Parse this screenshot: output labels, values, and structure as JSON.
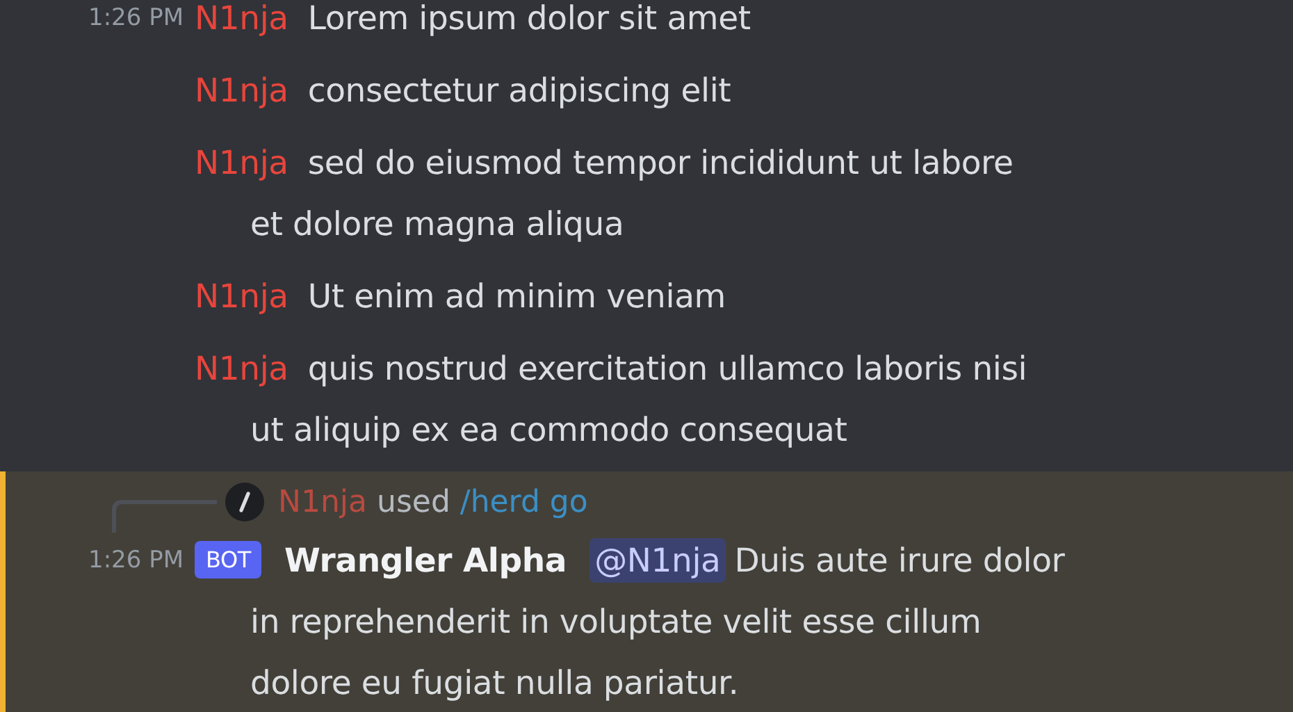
{
  "messages": [
    {
      "timestamp": "1:26 PM",
      "author": "N1nja",
      "lines": [
        "Lorem ipsum dolor sit amet"
      ]
    },
    {
      "author": "N1nja",
      "lines": [
        "consectetur adipiscing elit"
      ]
    },
    {
      "author": "N1nja",
      "lines": [
        "sed do eiusmod tempor incididunt ut labore",
        "et dolore magna aliqua"
      ]
    },
    {
      "author": "N1nja",
      "lines": [
        "Ut enim ad minim veniam"
      ]
    },
    {
      "author": "N1nja",
      "lines": [
        "quis nostrud exercitation ullamco laboris nisi",
        "ut aliquip ex ea commodo consequat"
      ]
    }
  ],
  "bot_message": {
    "highlighted": true,
    "reply": {
      "author": "N1nja",
      "verb": "used",
      "command": "/herd go"
    },
    "timestamp": "1:26 PM",
    "badge": "BOT",
    "author": "Wrangler Alpha",
    "mention": "@N1nja",
    "lines": [
      "Duis aute irure dolor",
      "in reprehenderit in voluptate velit esse cillum",
      "dolore eu fugiat nulla pariatur."
    ]
  }
}
